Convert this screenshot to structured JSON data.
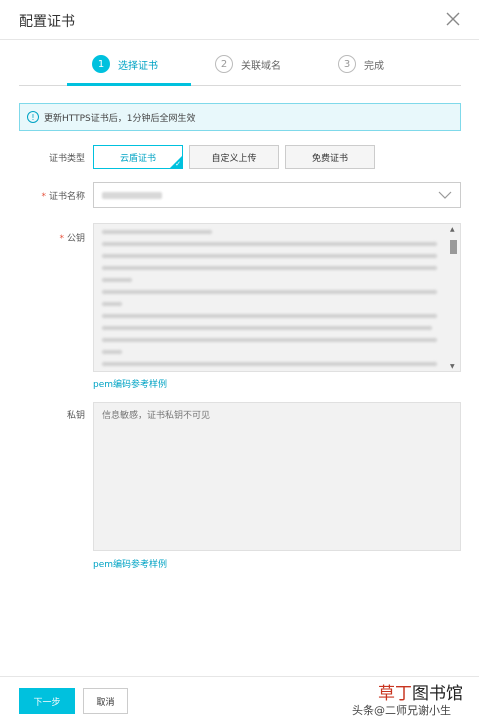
{
  "dialog": {
    "title": "配置证书"
  },
  "steps": [
    {
      "num": "1",
      "label": "选择证书"
    },
    {
      "num": "2",
      "label": "关联域名"
    },
    {
      "num": "3",
      "label": "完成"
    }
  ],
  "notice": {
    "text": "更新HTTPS证书后，1分钟后全网生效"
  },
  "form": {
    "cert_type_label": "证书类型",
    "cert_type_options": [
      "云盾证书",
      "自定义上传",
      "免费证书"
    ],
    "cert_name_required": "*",
    "cert_name_label": "证书名称",
    "public_key_required": "*",
    "public_key_label": "公钥",
    "pem_link_1": "pem编码参考样例",
    "private_key_label": "私钥",
    "private_key_placeholder": "信息敏感，证书私钥不可见",
    "pem_link_2": "pem编码参考样例"
  },
  "footer": {
    "next_label": "下一步",
    "cancel_label": "取消"
  },
  "watermark": {
    "brand_a": "草丁",
    "brand_b": "图书馆",
    "author": "头条@二师兄谢小生"
  },
  "colors": {
    "accent": "#00c1de",
    "link": "#00a3c4",
    "required": "#e5533d"
  }
}
